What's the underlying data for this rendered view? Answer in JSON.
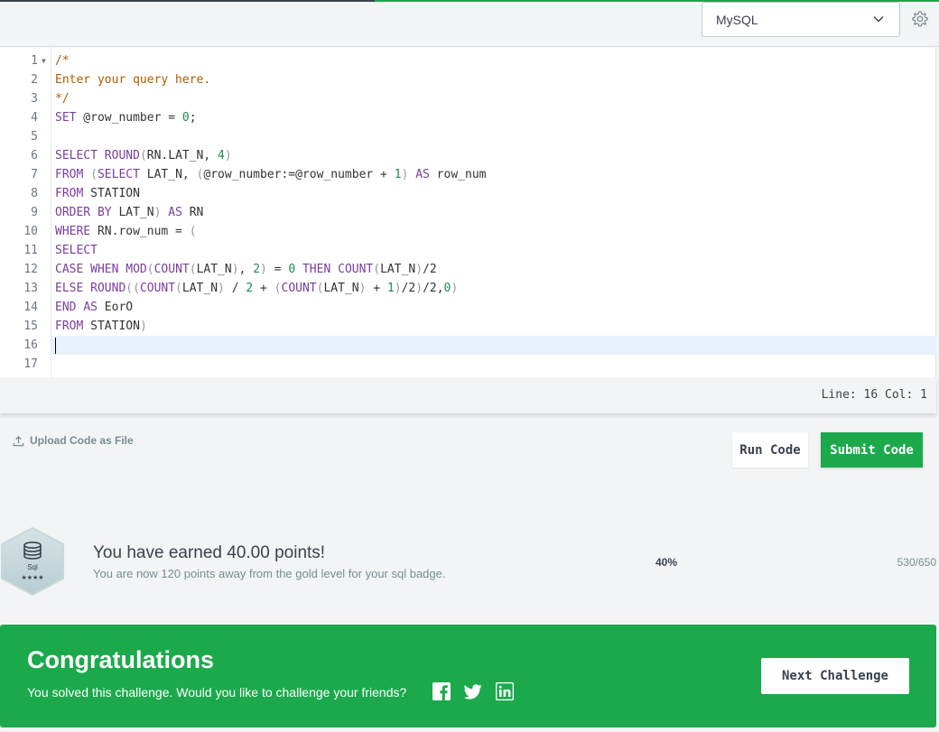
{
  "toolbar": {
    "language": "MySQL",
    "settings_icon": "gear-icon"
  },
  "editor": {
    "lines": [
      {
        "num": "1",
        "fold": true,
        "tokens": [
          [
            "c",
            "/*"
          ]
        ]
      },
      {
        "num": "2",
        "tokens": [
          [
            "c",
            "Enter your query here."
          ]
        ]
      },
      {
        "num": "3",
        "tokens": [
          [
            "c",
            "*/"
          ]
        ]
      },
      {
        "num": "4",
        "tokens": [
          [
            "k",
            "SET"
          ],
          [
            "v",
            " @row_number = "
          ],
          [
            "n",
            "0"
          ],
          [
            "v",
            ";"
          ]
        ]
      },
      {
        "num": "5",
        "tokens": []
      },
      {
        "num": "6",
        "tokens": [
          [
            "k",
            "SELECT"
          ],
          [
            "v",
            " "
          ],
          [
            "k",
            "ROUND"
          ],
          [
            "p",
            "("
          ],
          [
            "v",
            "RN.LAT_N, "
          ],
          [
            "n",
            "4"
          ],
          [
            "p",
            ")"
          ]
        ]
      },
      {
        "num": "7",
        "tokens": [
          [
            "k",
            "FROM"
          ],
          [
            "v",
            " "
          ],
          [
            "p",
            "("
          ],
          [
            "k",
            "SELECT"
          ],
          [
            "v",
            " LAT_N, "
          ],
          [
            "p",
            "("
          ],
          [
            "v",
            "@row_number:=@row_number + "
          ],
          [
            "n",
            "1"
          ],
          [
            "p",
            ")"
          ],
          [
            "v",
            " "
          ],
          [
            "k",
            "AS"
          ],
          [
            "v",
            " row_num"
          ]
        ]
      },
      {
        "num": "8",
        "tokens": [
          [
            "k",
            "FROM"
          ],
          [
            "v",
            " STATION"
          ]
        ]
      },
      {
        "num": "9",
        "tokens": [
          [
            "k",
            "ORDER BY"
          ],
          [
            "v",
            " LAT_N"
          ],
          [
            "p",
            ")"
          ],
          [
            "v",
            " "
          ],
          [
            "k",
            "AS"
          ],
          [
            "v",
            " RN"
          ]
        ]
      },
      {
        "num": "10",
        "tokens": [
          [
            "k",
            "WHERE"
          ],
          [
            "v",
            " RN.row_num = "
          ],
          [
            "p",
            "("
          ]
        ]
      },
      {
        "num": "11",
        "tokens": [
          [
            "k",
            "SELECT"
          ]
        ]
      },
      {
        "num": "12",
        "tokens": [
          [
            "k",
            "CASE WHEN"
          ],
          [
            "v",
            " "
          ],
          [
            "k",
            "MOD"
          ],
          [
            "p",
            "("
          ],
          [
            "k",
            "COUNT"
          ],
          [
            "p",
            "("
          ],
          [
            "v",
            "LAT_N"
          ],
          [
            "p",
            ")"
          ],
          [
            "v",
            ", "
          ],
          [
            "n",
            "2"
          ],
          [
            "p",
            ")"
          ],
          [
            "v",
            " = "
          ],
          [
            "n",
            "0"
          ],
          [
            "v",
            " "
          ],
          [
            "k",
            "THEN"
          ],
          [
            "v",
            " "
          ],
          [
            "k",
            "COUNT"
          ],
          [
            "p",
            "("
          ],
          [
            "v",
            "LAT_N"
          ],
          [
            "p",
            ")"
          ],
          [
            "v",
            "/2"
          ]
        ]
      },
      {
        "num": "13",
        "tokens": [
          [
            "k",
            "ELSE"
          ],
          [
            "v",
            " "
          ],
          [
            "k",
            "ROUND"
          ],
          [
            "p",
            "(("
          ],
          [
            "k",
            "COUNT"
          ],
          [
            "p",
            "("
          ],
          [
            "v",
            "LAT_N"
          ],
          [
            "p",
            ")"
          ],
          [
            "v",
            " / "
          ],
          [
            "n",
            "2"
          ],
          [
            "v",
            " + "
          ],
          [
            "p",
            "("
          ],
          [
            "k",
            "COUNT"
          ],
          [
            "p",
            "("
          ],
          [
            "v",
            "LAT_N"
          ],
          [
            "p",
            ")"
          ],
          [
            "v",
            " + "
          ],
          [
            "n",
            "1"
          ],
          [
            "p",
            ")"
          ],
          [
            "v",
            "/2"
          ],
          [
            "p",
            ")"
          ],
          [
            "v",
            "/2,"
          ],
          [
            "n",
            "0"
          ],
          [
            "p",
            ")"
          ]
        ]
      },
      {
        "num": "14",
        "tokens": [
          [
            "k",
            "END"
          ],
          [
            "v",
            " "
          ],
          [
            "k",
            "AS"
          ],
          [
            "v",
            " EorO"
          ]
        ]
      },
      {
        "num": "15",
        "tokens": [
          [
            "k",
            "FROM"
          ],
          [
            "v",
            " STATION"
          ],
          [
            "p",
            ")"
          ]
        ]
      },
      {
        "num": "16",
        "active": true,
        "tokens": []
      },
      {
        "num": "17",
        "tokens": []
      }
    ],
    "status": "Line: 16 Col: 1"
  },
  "actions": {
    "upload_label": "Upload Code as File",
    "run_label": "Run Code",
    "submit_label": "Submit Code"
  },
  "badge": {
    "name": "Sql",
    "stars": "★★★★"
  },
  "progress": {
    "title": "You have earned 40.00 points!",
    "subtitle": "You are now 120 points away from the gold level for your sql badge.",
    "percent_label": "40%",
    "score": "530/650"
  },
  "congrats": {
    "title": "Congratulations",
    "message": "You solved this challenge. Would you like to challenge your friends?",
    "next_label": "Next Challenge"
  }
}
